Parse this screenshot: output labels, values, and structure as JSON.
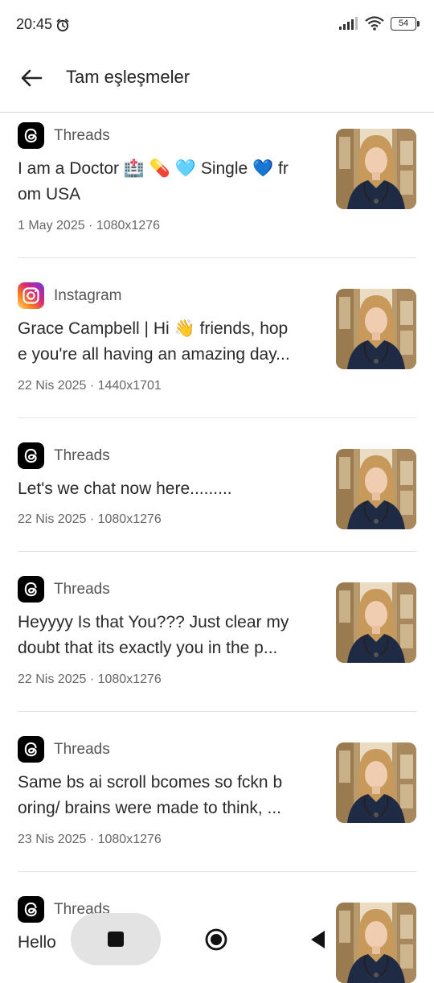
{
  "status_bar": {
    "time": "20:45",
    "battery": "54"
  },
  "app_bar": {
    "title": "Tam eşleşmeler"
  },
  "results": [
    {
      "source": "Threads",
      "icon": "threads-logo",
      "caption_line1": "I am a Doctor 🏥 💊 🩵 Single 💙 fr",
      "caption_line2": "om USA",
      "meta": "1 May 2025 · 1080x1276"
    },
    {
      "source": "Instagram",
      "icon": "instagram-logo",
      "caption_line1": "Grace Campbell | Hi 👋 friends, hop",
      "caption_line2": "e you're all having an amazing day...",
      "meta": "22 Nis 2025 · 1440x1701"
    },
    {
      "source": "Threads",
      "icon": "threads-logo",
      "caption_line1": "Let's we chat now here.........",
      "caption_line2": "",
      "meta": "22 Nis 2025 · 1080x1276"
    },
    {
      "source": "Threads",
      "icon": "threads-logo",
      "caption_line1": "Heyyyy Is that You??? Just clear my",
      "caption_line2": "doubt that its exactly you in the p...",
      "meta": "22 Nis 2025 · 1080x1276"
    },
    {
      "source": "Threads",
      "icon": "threads-logo",
      "caption_line1": "Same bs ai scroll bcomes so fckn b",
      "caption_line2": "oring/ brains were made to think, ...",
      "meta": "23 Nis 2025 · 1080x1276"
    },
    {
      "source": "Threads",
      "icon": "threads-logo",
      "caption_line1": "Hello",
      "caption_line2": "",
      "meta": ""
    }
  ],
  "colors": {
    "threads_bg": "#000000",
    "instagram_gradient": [
      "#feda75",
      "#fa7e1e",
      "#d62976",
      "#962fbf",
      "#4f5bd5"
    ]
  }
}
